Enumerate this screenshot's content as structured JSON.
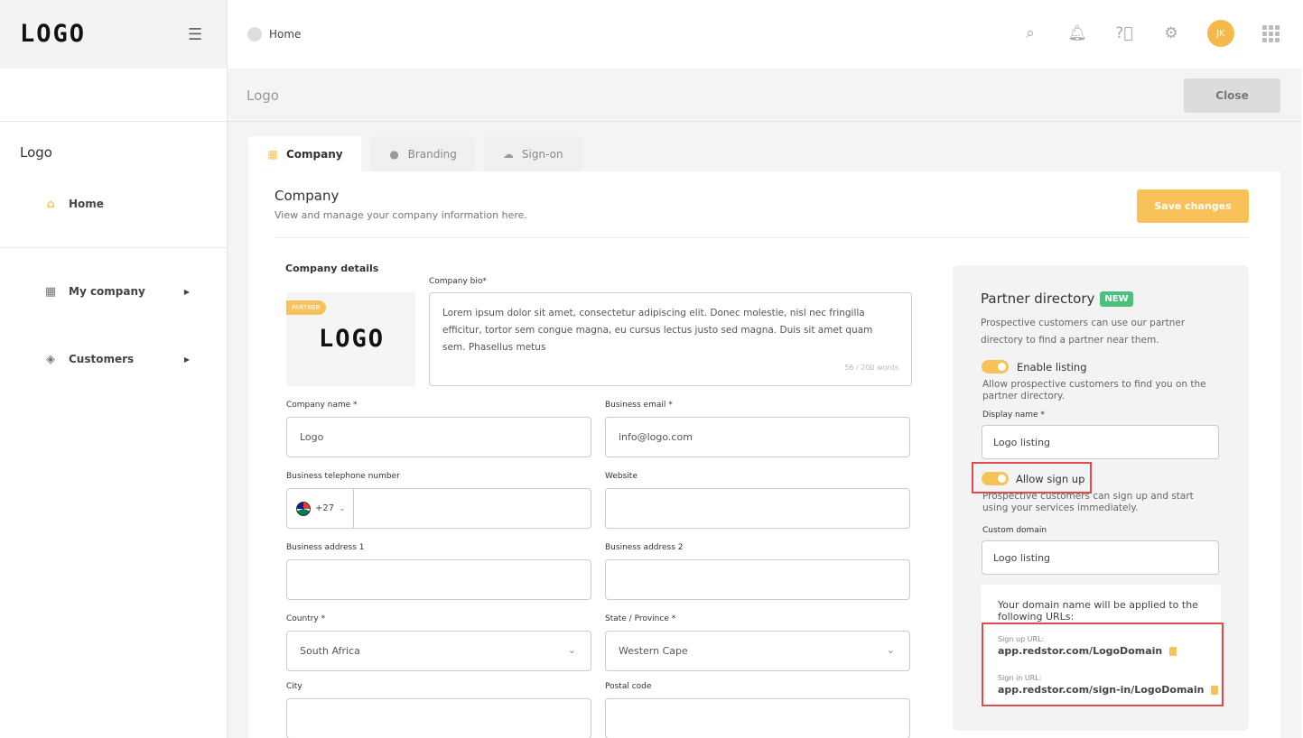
{
  "app": {
    "logo": "LOGO",
    "breadcrumb": "Home",
    "avatar_initials": "JK"
  },
  "sidebar": {
    "section_title": "Logo",
    "items": [
      {
        "label": "Home"
      },
      {
        "label": "My company"
      },
      {
        "label": "Customers"
      }
    ]
  },
  "page": {
    "title": "Logo",
    "close_label": "Close"
  },
  "tabs": [
    {
      "label": "Company"
    },
    {
      "label": "Branding"
    },
    {
      "label": "Sign-on"
    }
  ],
  "company": {
    "title": "Company",
    "subtitle": "View and manage your company information here.",
    "save_label": "Save changes",
    "details_label": "Company details",
    "partner_badge": "PARTNER",
    "logo_text": "LOGO",
    "bio_label": "Company bio*",
    "bio_text": "Lorem ipsum dolor sit amet, consectetur adipiscing elit. Donec molestie, nisl nec fringilla efficitur, tortor sem congue magna, eu cursus lectus justo sed magna. Duis sit amet quam sem. Phasellus metus",
    "bio_count": "56 / 200 words",
    "fields": {
      "company_name": {
        "label": "Company name *",
        "value": "Logo"
      },
      "business_email": {
        "label": "Business email *",
        "value": "info@logo.com"
      },
      "phone": {
        "label": "Business telephone number",
        "prefix": "+27",
        "value": ""
      },
      "website": {
        "label": "Website",
        "value": ""
      },
      "address1": {
        "label": "Business address 1",
        "value": ""
      },
      "address2": {
        "label": "Business address 2",
        "value": ""
      },
      "country": {
        "label": "Country *",
        "value": "South Africa"
      },
      "state": {
        "label": "State / Province *",
        "value": "Western Cape"
      },
      "city": {
        "label": "City",
        "value": ""
      },
      "postal": {
        "label": "Postal code",
        "value": ""
      }
    }
  },
  "partner_directory": {
    "title": "Partner directory",
    "badge": "NEW",
    "description": "Prospective customers can use our partner directory to find a partner near them.",
    "enable_listing_label": "Enable listing",
    "enable_listing_desc": "Allow prospective customers to find you on the partner directory.",
    "display_name_label": "Display name *",
    "display_name_value": "Logo listing",
    "allow_signup_label": "Allow sign up",
    "allow_signup_desc": "Prospective customers can sign up and start using your services immediately.",
    "custom_domain_label": "Custom domain",
    "custom_domain_value": "Logo listing",
    "url_hint": "Your domain name will be applied to the following URLs:",
    "signup_url_label": "Sign up URL:",
    "signup_url": "app.redstor.com/LogoDomain",
    "signin_url_label": "Sign in URL:",
    "signin_url": "app.redstor.com/sign-in/LogoDomain"
  },
  "colors": {
    "accent": "#f8c25a",
    "new_badge": "#4fbf7e",
    "highlight": "#e04a4a"
  }
}
